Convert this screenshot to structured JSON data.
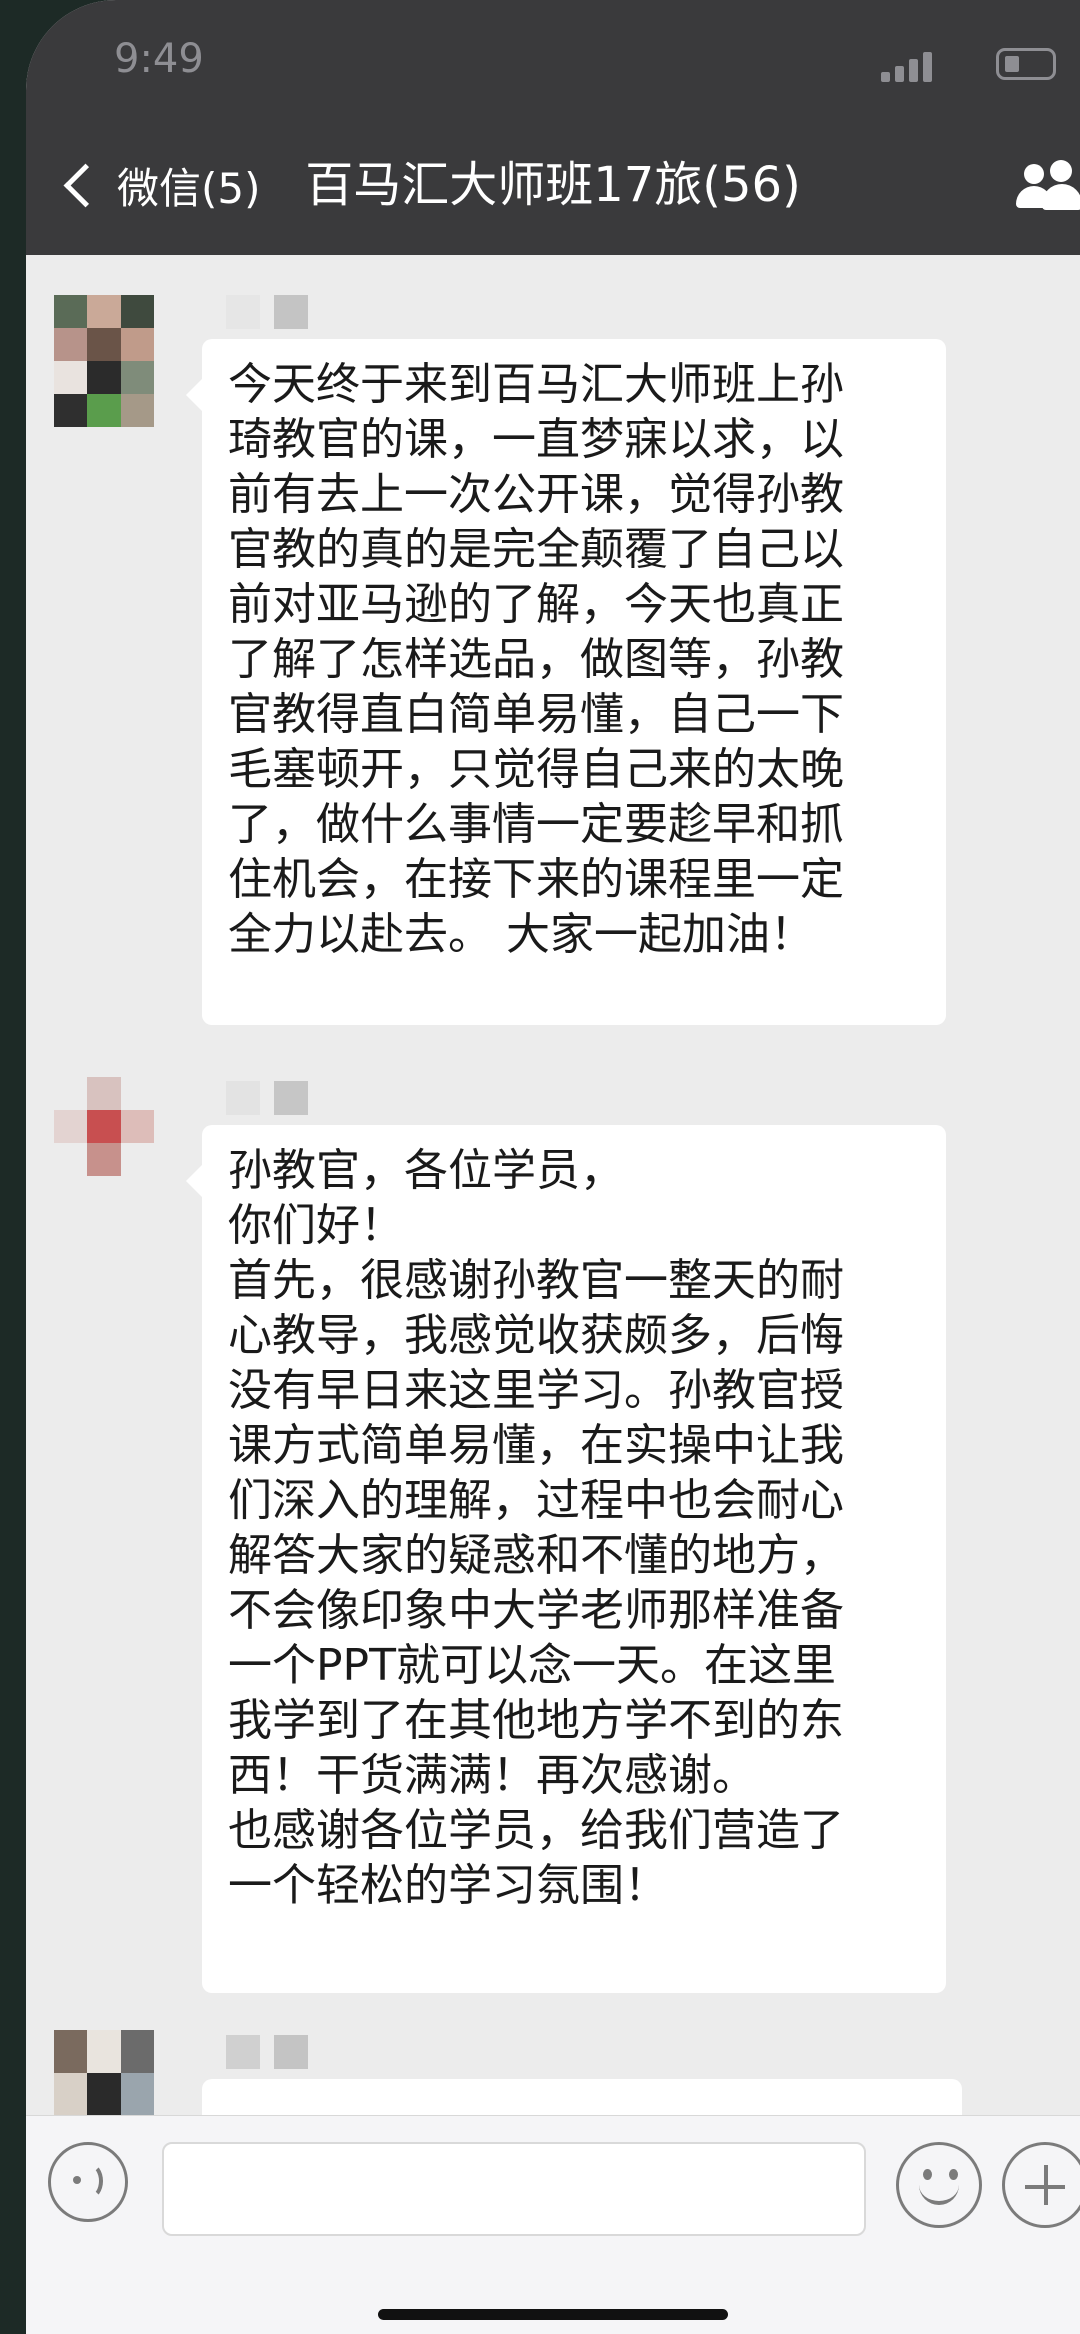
{
  "status_bar": {
    "time": "9:49",
    "signal_icon": "signal-icon",
    "battery_icon": "battery-icon"
  },
  "nav": {
    "back_label": "微信(5)",
    "title": "百马汇大师班17旅(56)",
    "right_icon": "group-members-icon"
  },
  "messages": [
    {
      "avatar": "avatar-pixelated",
      "sender": "",
      "lines": [
        "今天终于来到百马汇大师班上孙",
        "琦教官的课，一直梦寐以求，以",
        "前有去上一次公开课，觉得孙教",
        "官教的真的是完全颠覆了自己以",
        "前对亚马逊的了解，今天也真正",
        "了解了怎样选品，做图等，孙教",
        "官教得直白简单易懂，自己一下",
        "毛塞顿开，只觉得自己来的太晚",
        "了，做什么事情一定要趁早和抓",
        "住机会，在接下来的课程里一定",
        "全力以赴去。 大家一起加油！"
      ]
    },
    {
      "avatar": "avatar-pixelated",
      "sender": "",
      "lines": [
        "孙教官，各位学员，",
        "你们好！",
        "首先，很感谢孙教官一整天的耐",
        "心教导，我感觉收获颇多，后悔",
        "没有早日来这里学习。孙教官授",
        "课方式简单易懂，在实操中让我",
        "们深入的理解，过程中也会耐心",
        "解答大家的疑惑和不懂的地方，",
        "不会像印象中大学老师那样准备",
        "一个PPT就可以念一天。在这里",
        "我学到了在其他地方学不到的东",
        "西！干货满满！再次感谢。",
        "也感谢各位学员，给我们营造了",
        "一个轻松的学习氛围！"
      ]
    }
  ],
  "input_bar": {
    "voice_icon": "voice-icon",
    "text_value": "",
    "emoji_icon": "emoji-icon",
    "plus_icon": "plus-icon"
  }
}
